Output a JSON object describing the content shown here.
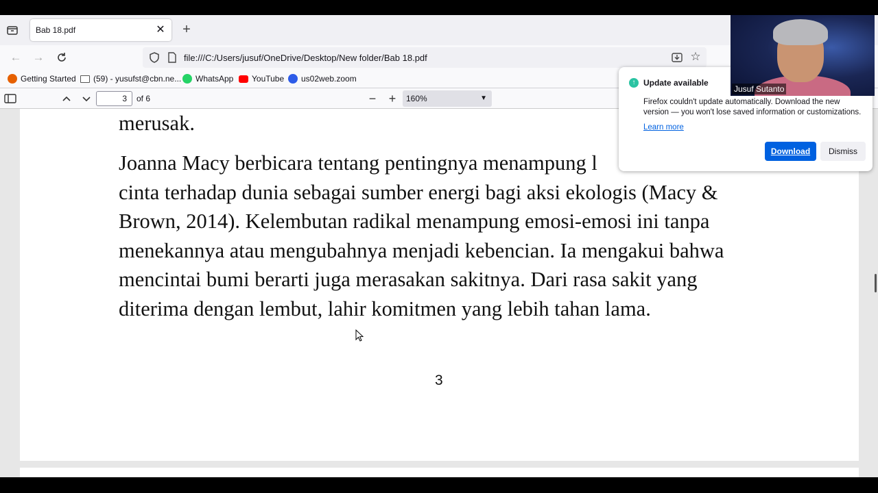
{
  "browser": {
    "tab": {
      "title": "Bab 18.pdf",
      "close_glyph": "✕",
      "new_tab_glyph": "+"
    },
    "url": "file:///C:/Users/jusuf/OneDrive/Desktop/New folder/Bab 18.pdf",
    "bookmarks": [
      {
        "label": "Getting Started",
        "icon": "firefox-icon",
        "color": "#e66000"
      },
      {
        "label": "(59) - yusufst@cbn.ne...",
        "icon": "mail-icon",
        "color": "#555555"
      },
      {
        "label": "WhatsApp",
        "icon": "whatsapp-icon",
        "color": "#25d366"
      },
      {
        "label": "YouTube",
        "icon": "youtube-icon",
        "color": "#ff0000"
      },
      {
        "label": "us02web.zoom",
        "icon": "zoom-icon",
        "color": "#2d5ce8"
      }
    ]
  },
  "pdf_toolbar": {
    "page_current": "3",
    "page_total_label": "of 6",
    "zoom_value": "160%"
  },
  "document": {
    "lines": [
      "merusak.",
      "Joanna Macy berbicara tentang pentingnya menampung l",
      "cinta terhadap dunia sebagai sumber energi bagi aksi ekologis (Macy &",
      "Brown, 2014). Kelembutan radikal menampung emosi-emosi ini tanpa",
      "menekannya atau mengubahnya menjadi kebencian. Ia mengakui bahwa",
      "mencintai bumi berarti juga merasakan sakitnya. Dari rasa sakit yang",
      "diterima dengan lembut, lahir komitmen yang lebih tahan lama."
    ],
    "page_number": "3"
  },
  "notification": {
    "title": "Update available",
    "body": "Firefox couldn't update automatically. Download the new version — you won't lose saved information or customizations.",
    "link": "Learn more",
    "download_label": "Download",
    "dismiss_label": "Dismiss",
    "accent": "#0061e0"
  },
  "webcam": {
    "name": "Jusuf Sutanto"
  }
}
